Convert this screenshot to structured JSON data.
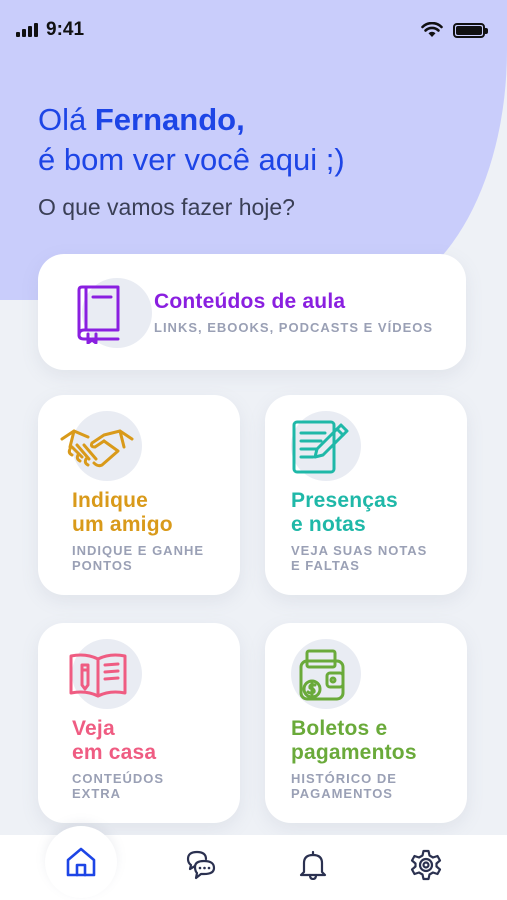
{
  "status_bar": {
    "time": "9:41"
  },
  "greeting": {
    "hello": "Olá ",
    "name": "Fernando,",
    "line2": "é bom ver você aqui ;)",
    "question": "O que vamos fazer hoje?"
  },
  "cards": {
    "conteudos": {
      "title": "Conteúdos de aula",
      "subtitle": "LINKS, EBOOKS, PODCASTS E VÍDEOS",
      "color": "#8a1fe0",
      "icon": "book-icon"
    },
    "indique": {
      "title1": "Indique",
      "title2": "um amigo",
      "sub1": "INDIQUE E GANHE",
      "sub2": "PONTOS",
      "color": "#d99a1a",
      "icon": "handshake-icon"
    },
    "presencas": {
      "title1": "Presenças",
      "title2": "e notas",
      "sub1": "VEJA SUAS NOTAS",
      "sub2": "E FALTAS",
      "color": "#1fb8a8",
      "icon": "notepad-pen-icon"
    },
    "veja": {
      "title1": "Veja",
      "title2": "em casa",
      "sub1": "CONTEÚDOS",
      "sub2": "EXTRA",
      "color": "#ef5c82",
      "icon": "open-book-pencil-icon"
    },
    "boletos": {
      "title1": "Boletos e",
      "title2": "pagamentos",
      "sub1": "HISTÓRICO DE",
      "sub2": "PAGAMENTOS",
      "color": "#6aaa3a",
      "icon": "wallet-money-icon"
    }
  },
  "tabbar": {
    "items": [
      "home-icon",
      "chat-icon",
      "bell-icon",
      "gear-icon"
    ],
    "active_color": "#1d45e6",
    "inactive_color": "#2b3150"
  }
}
